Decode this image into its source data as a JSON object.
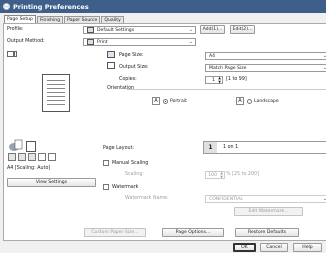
{
  "window": {
    "title": "Printing Preferences",
    "icon": "printer-icon"
  },
  "tabs": [
    "Page Setup",
    "Finishing",
    "Paper Source",
    "Quality"
  ],
  "profile": {
    "label": "Profile:",
    "value": "Default Settings",
    "add_button": "Add(1)...",
    "edit_button": "Edit(2)..."
  },
  "output_method": {
    "label": "Output Method:",
    "value": "Print"
  },
  "page_size": {
    "label": "Page Size:",
    "value": "A4"
  },
  "output_size": {
    "label": "Output Size:",
    "value": "Match Page Size"
  },
  "copies": {
    "label": "Copies:",
    "value": "1",
    "range": "[1 to 99]"
  },
  "orientation": {
    "label": "Orientation",
    "portrait": "Portrait",
    "landscape": "Landscape",
    "selected": "Portrait",
    "glyph": "A"
  },
  "page_layout": {
    "label": "Page Layout:",
    "number": "1",
    "value": "1 on 1"
  },
  "manual_scaling": {
    "label": "Manual Scaling",
    "scaling_label": "Scaling:",
    "scaling_value": "100",
    "range": "% [25 to 200]"
  },
  "watermark": {
    "label": "Watermark",
    "name_label": "Watermark Name:",
    "name_value": "CONFIDENTIAL",
    "edit_button": "Edit Watermark..."
  },
  "preview": {
    "caption": "A4 [Scaling: Auto]",
    "view_settings_button": "View Settings"
  },
  "footer": {
    "custom_paper_size": "Custom Paper Size...",
    "page_options": "Page Options...",
    "restore_defaults": "Restore Defaults",
    "ok": "OK",
    "cancel": "Cancel",
    "help": "Help"
  }
}
